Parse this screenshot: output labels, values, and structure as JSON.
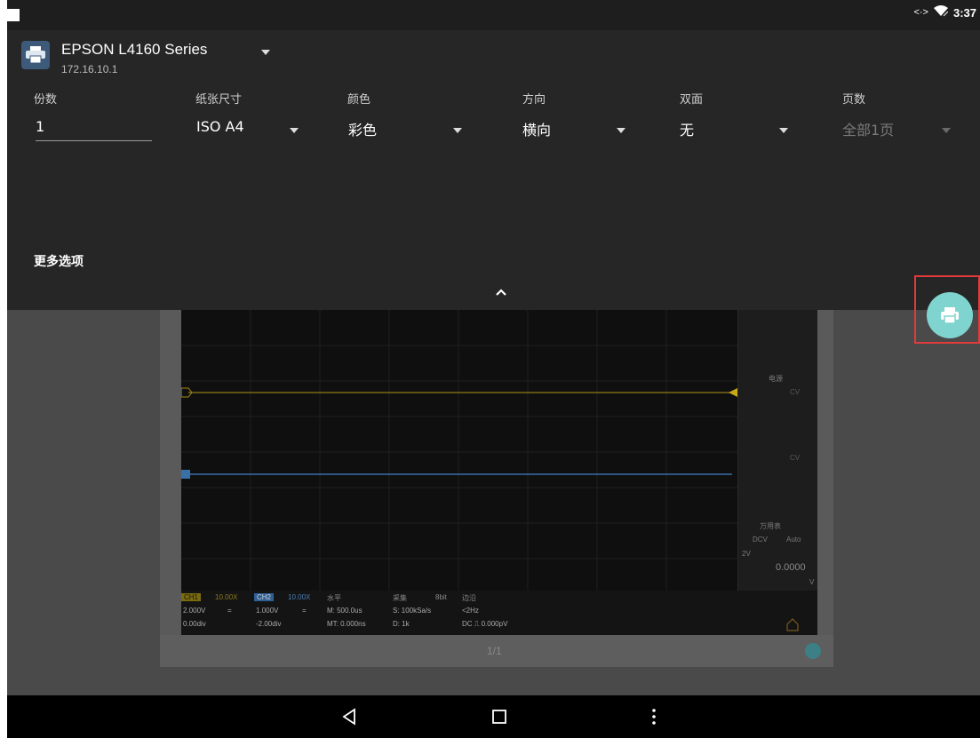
{
  "status_bar": {
    "time": "3:37",
    "data_icon": "data-transfer-icon",
    "wifi_icon": "wifi-icon"
  },
  "printer": {
    "name": "EPSON L4160 Series",
    "ip": "172.16.10.1"
  },
  "options": {
    "copies": {
      "label": "份数",
      "value": "1"
    },
    "paper_size": {
      "label": "纸张尺寸",
      "value": "ISO A4"
    },
    "color": {
      "label": "颜色",
      "value": "彩色"
    },
    "orientation": {
      "label": "方向",
      "value": "横向"
    },
    "duplex": {
      "label": "双面",
      "value": "无"
    },
    "pages": {
      "label": "页数",
      "value": "全部1页"
    }
  },
  "more_options_label": "更多选项",
  "preview": {
    "page_number": "1/1",
    "channels": {
      "ch1": {
        "name": "CH1",
        "probe": "10.00X",
        "scale": "2.000V",
        "coupling": "=",
        "offset": "0.00div"
      },
      "ch2": {
        "name": "CH2",
        "probe": "10.00X",
        "scale": "1.000V",
        "coupling": "=",
        "offset": "-2.00div"
      }
    },
    "horizontal": {
      "title": "水平",
      "main": "M: 500.0us",
      "mt": "MT: 0.000ns"
    },
    "acquire": {
      "title": "采集",
      "bits": "8bit",
      "rate": "S: 100kSa/s",
      "depth": "D: 1k"
    },
    "trigger": {
      "title": "边沿",
      "freq": "<2Hz",
      "level": "DC ⎍ 0.000pV"
    },
    "side": {
      "power_title": "电源",
      "meter_title": "万用表",
      "meter_mode": "DCV",
      "meter_range": "Auto",
      "meter_scale": "2V",
      "meter_value": "0.0000",
      "meter_unit": "V",
      "cv": "CV"
    }
  },
  "colors": {
    "accent": "#7fd4cf",
    "ch1": "#d4b21a",
    "ch2": "#4a8fd8",
    "highlight_box": "#e23a3a"
  }
}
